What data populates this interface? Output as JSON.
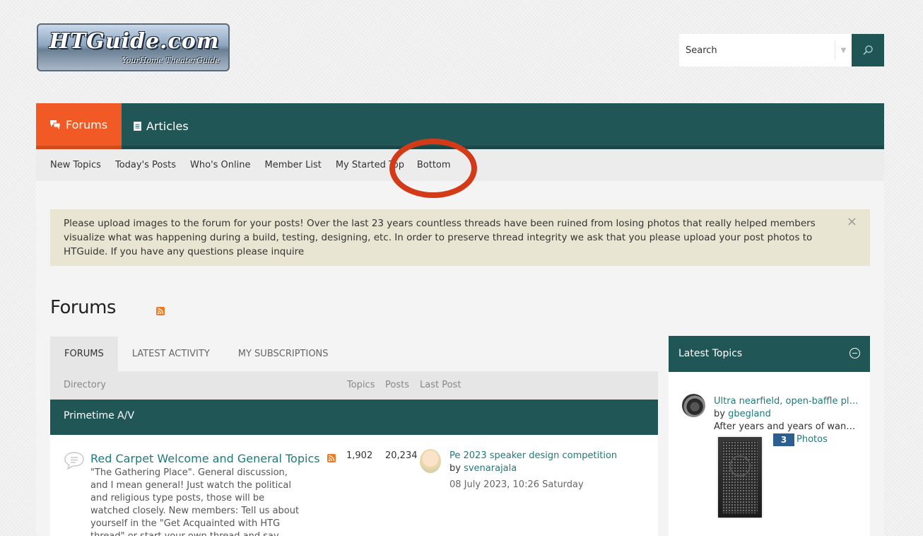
{
  "logo": {
    "title": "HTGuide.com",
    "tagline": "YourHome TheaterGuide"
  },
  "search": {
    "placeholder": "Search"
  },
  "nav": {
    "tabs": [
      {
        "label": "Forums",
        "active": true
      },
      {
        "label": "Articles",
        "active": false
      }
    ],
    "sub": [
      "New Topics",
      "Today's Posts",
      "Who's Online",
      "Member List",
      "My Started Topics",
      "Bottom"
    ]
  },
  "notice": {
    "text": "Please upload images to the forum for your posts! Over the last 23 years countless threads have been ruined from losing photos that really helped members visualize what was happening during a build, testing, designing, etc. In order to preserve thread integrity we ask that you please upload your post photos to HTGuide. If you have any questions please inquire",
    "close": "×"
  },
  "page": {
    "title": "Forums"
  },
  "tabs": [
    "FORUMS",
    "LATEST ACTIVITY",
    "MY SUBSCRIPTIONS"
  ],
  "columns": {
    "directory": "Directory",
    "topics": "Topics",
    "posts": "Posts",
    "last_post": "Last Post"
  },
  "category": {
    "name": "Primetime A/V"
  },
  "forum": {
    "title": "Red Carpet Welcome and General Topics",
    "description": "\"The Gathering Place\". General discussion, and I mean general! Just watch the political and religious type posts, those will be watched closely. New members: Tell us about yourself in the \"Get Acquainted with HTG thread\" or start your own thread and say hello to all of us!",
    "topics": "1,902",
    "posts": "20,234",
    "last_post": {
      "title": "Pe 2023 speaker design competition",
      "by_prefix": "by",
      "author": "svenarajala",
      "date": "08 July 2023, 10:26 Saturday"
    }
  },
  "sidebar": {
    "title": "Latest Topics",
    "item": {
      "title": "Ultra nearfield, open-baffle plans",
      "by_prefix": "by",
      "author": "gbegland",
      "snippet": "After years and years of wanting to build",
      "photo_count": "3",
      "photo_label": "Photos"
    }
  },
  "colors": {
    "nav": "#215656",
    "active_tab": "#f15a24",
    "link": "#1f7a7a",
    "annotation": "#d33a17"
  }
}
